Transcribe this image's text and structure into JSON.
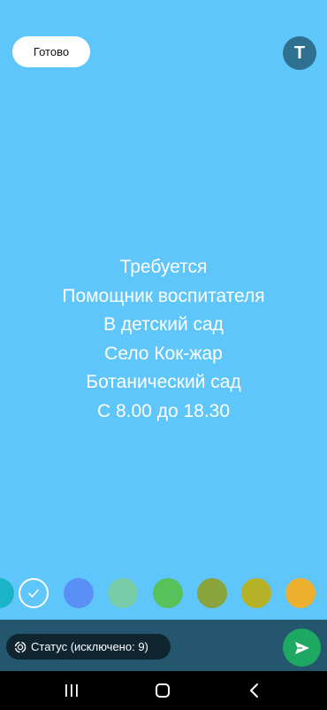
{
  "header": {
    "done_label": "Готово",
    "text_tool_label": "T"
  },
  "status": {
    "background_color": "#5ec6fb",
    "lines": [
      "Требуется",
      "Помощник воспитателя",
      "В детский сад",
      "Село Кок-жар",
      "Ботанический сад",
      "С 8.00 до 18.30"
    ]
  },
  "palette": {
    "colors": [
      "#1bb3c8",
      "#5ec6fb",
      "#5a8ff5",
      "#78cda8",
      "#57c25a",
      "#8aa43d",
      "#b6b227",
      "#ecb02e"
    ],
    "selected_color": "#5ec6fb"
  },
  "footer": {
    "audience_label": "Статус (исключено: 9)",
    "audience_icon": "status-ring-icon",
    "send_icon": "send-icon"
  },
  "system_nav": {
    "recents_icon": "recents-icon",
    "home_icon": "home-icon",
    "back_icon": "back-icon"
  }
}
